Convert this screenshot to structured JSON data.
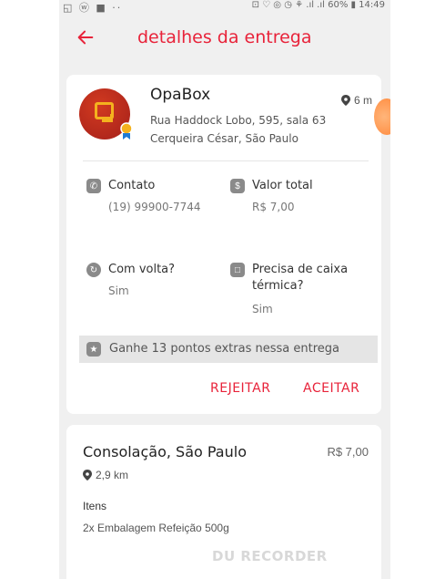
{
  "status_bar": {
    "left_icons": "◱ ⓦ ■ ··",
    "right_info": "⊡ ♡ ◎ ◷ ⚘ .ıl .ıl 60% ▮ 14:49"
  },
  "header": {
    "title": "detalhes da entrega",
    "back_icon": "arrow-left-icon"
  },
  "store": {
    "name": "OpaBox",
    "distance": "6 m",
    "address_line1": "Rua Haddock Lobo, 595, sala 63",
    "address_line2": "Cerqueira César, São Paulo"
  },
  "details": {
    "contact_label": "Contato",
    "contact_value": "(19) 99900-7744",
    "total_label": "Valor total",
    "total_value": "R$ 7,00",
    "return_label": "Com volta?",
    "return_value": "Sim",
    "thermal_label_1": "Precisa de caixa",
    "thermal_label_2": "térmica?",
    "thermal_value": "Sim"
  },
  "bonus": {
    "text": "Ganhe 13 pontos extras nessa entrega"
  },
  "actions": {
    "reject": "REJEITAR",
    "accept": "ACEITAR"
  },
  "next_order": {
    "title": "Consolação, São Paulo",
    "price": "R$ 7,00",
    "distance": "2,9 km",
    "items_label": "Itens",
    "items_value": "2x Embalagem Refeição 500g"
  },
  "watermark": "DU RECORDER",
  "colors": {
    "accent": "#e8233a",
    "background": "#f0f0f0",
    "card": "#ffffff",
    "icon_gray": "#8a8a8a"
  }
}
